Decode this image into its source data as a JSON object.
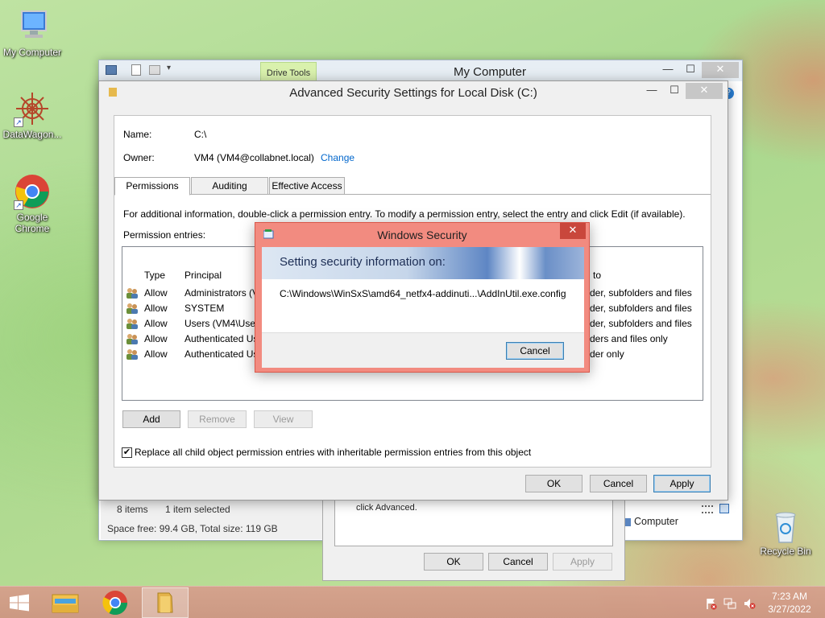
{
  "desktop": {
    "icons": [
      {
        "label": "My Computer"
      },
      {
        "label": "DataWagon..."
      },
      {
        "label": "Google Chrome"
      },
      {
        "label": "Recycle Bin"
      }
    ]
  },
  "explorer": {
    "contextual_tab": "Drive Tools",
    "title": "My Computer",
    "status": {
      "items": "8 items",
      "selected": "1 item selected",
      "space": "Space free: 99.4 GB, Total size: 119 GB"
    },
    "right_status": "Computer"
  },
  "properties_dialog": {
    "text": "click Advanced.",
    "ok": "OK",
    "cancel": "Cancel",
    "apply": "Apply"
  },
  "advanced_security": {
    "title": "Advanced Security Settings for Local Disk (C:)",
    "name_label": "Name:",
    "name_value": "C:\\",
    "owner_label": "Owner:",
    "owner_value": "VM4 (VM4@collabnet.local)",
    "change_link": "Change",
    "tabs": [
      {
        "label": "Permissions"
      },
      {
        "label": "Auditing"
      },
      {
        "label": "Effective Access"
      }
    ],
    "info_text": "For additional information, double-click a permission entry. To modify a permission entry, select the entry and click Edit (if available).",
    "entries_label": "Permission entries:",
    "columns": {
      "type": "Type",
      "principal": "Principal",
      "applies_to": "to"
    },
    "entries": [
      {
        "type": "Allow",
        "principal": "Administrators (V",
        "applies_to": "der, subfolders and files"
      },
      {
        "type": "Allow",
        "principal": "SYSTEM",
        "applies_to": "der, subfolders and files"
      },
      {
        "type": "Allow",
        "principal": "Users (VM4\\User",
        "applies_to": "der, subfolders and files"
      },
      {
        "type": "Allow",
        "principal": "Authenticated Us",
        "applies_to": "ders and files only"
      },
      {
        "type": "Allow",
        "principal": "Authenticated Us",
        "applies_to": "der only"
      }
    ],
    "buttons": {
      "add": "Add",
      "remove": "Remove",
      "view": "View"
    },
    "replace_checkbox": "Replace all child object permission entries with inheritable permission entries from this object",
    "replace_checked": true,
    "footer": {
      "ok": "OK",
      "cancel": "Cancel",
      "apply": "Apply"
    }
  },
  "windows_security": {
    "title": "Windows Security",
    "heading": "Setting security information on:",
    "path": "C:\\Windows\\WinSxS\\amd64_netfx4-addinuti...\\AddInUtil.exe.config",
    "cancel": "Cancel"
  },
  "taskbar": {
    "time": "7:23 AM",
    "date": "3/27/2022"
  }
}
